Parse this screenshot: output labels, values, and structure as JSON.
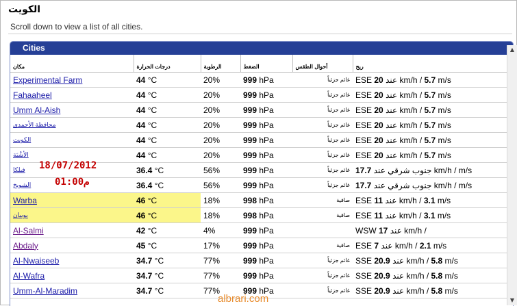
{
  "page": {
    "title": "الكويت",
    "subtitle": "Scroll down to view a list of all cities."
  },
  "panel": {
    "title": "Cities"
  },
  "columns": {
    "place": "مكان",
    "temperature": "درجات الحرارة",
    "humidity": "الرطوبة",
    "pressure": "الضغط",
    "weather": "أحوال الطقس",
    "wind": "ريح"
  },
  "rows": [
    {
      "city": "Experimental Farm",
      "temp": "44",
      "temp_unit": " °C",
      "humidity": "20%",
      "pressure": "999",
      "pressure_unit": " hPa",
      "weather": "غائم جزئياً",
      "wind_pre": "ESE ",
      "wind_kmh": "20",
      "wind_mid": " عند km/h / ",
      "wind_ms": "5.7",
      "wind_post": " m/s"
    },
    {
      "city": "Fahaaheel",
      "temp": "44",
      "temp_unit": " °C",
      "humidity": "20%",
      "pressure": "999",
      "pressure_unit": " hPa",
      "weather": "غائم جزئياً",
      "wind_pre": "ESE ",
      "wind_kmh": "20",
      "wind_mid": " عند km/h / ",
      "wind_ms": "5.7",
      "wind_post": " m/s"
    },
    {
      "city": "Umm Al-Aish",
      "temp": "44",
      "temp_unit": " °C",
      "humidity": "20%",
      "pressure": "999",
      "pressure_unit": " hPa",
      "weather": "غائم جزئياً",
      "wind_pre": "ESE ",
      "wind_kmh": "20",
      "wind_mid": " عند km/h / ",
      "wind_ms": "5.7",
      "wind_post": " m/s"
    },
    {
      "city": "محافظة الأحمدي",
      "temp": "44",
      "temp_unit": " °C",
      "humidity": "20%",
      "pressure": "999",
      "pressure_unit": " hPa",
      "weather": "غائم جزئياً",
      "wind_pre": "ESE ",
      "wind_kmh": "20",
      "wind_mid": " عند km/h / ",
      "wind_ms": "5.7",
      "wind_post": " m/s"
    },
    {
      "city": "الكويت",
      "temp": "44",
      "temp_unit": " °C",
      "humidity": "20%",
      "pressure": "999",
      "pressure_unit": " hPa",
      "weather": "غائم جزئياً",
      "wind_pre": "ESE ",
      "wind_kmh": "20",
      "wind_mid": " عند km/h / ",
      "wind_ms": "5.7",
      "wind_post": " m/s"
    },
    {
      "city": "الأشْبَة",
      "temp": "44",
      "temp_unit": " °C",
      "humidity": "20%",
      "pressure": "999",
      "pressure_unit": " hPa",
      "weather": "غائم جزئياً",
      "wind_pre": "ESE ",
      "wind_kmh": "20",
      "wind_mid": " عند km/h / ",
      "wind_ms": "5.7",
      "wind_post": " m/s"
    },
    {
      "city": "فيلكا",
      "temp": "36.4",
      "temp_unit": " °C",
      "humidity": "56%",
      "pressure": "999",
      "pressure_unit": " hPa",
      "weather": "غائم جزئياً",
      "wind_pre": "",
      "wind_kmh": "17.7",
      "wind_mid": " جنوب شرقي عند km/h /  m/s",
      "wind_ms": "",
      "wind_post": ""
    },
    {
      "city": "الشويخ",
      "temp": "36.4",
      "temp_unit": " °C",
      "humidity": "56%",
      "pressure": "999",
      "pressure_unit": " hPa",
      "weather": "غائم جزئياً",
      "wind_pre": "",
      "wind_kmh": "17.7",
      "wind_mid": " جنوب شرقي عند km/h /  m/s",
      "wind_ms": "",
      "wind_post": ""
    },
    {
      "city": "Warba",
      "temp": "46",
      "temp_unit": " °C",
      "humidity": "18%",
      "pressure": "998",
      "pressure_unit": " hPa",
      "weather": "صافية",
      "wind_pre": "ESE ",
      "wind_kmh": "11",
      "wind_mid": " عند km/h / ",
      "wind_ms": "3.1",
      "wind_post": " m/s",
      "highlight": true
    },
    {
      "city": "بوبيان",
      "temp": "46",
      "temp_unit": " °C",
      "humidity": "18%",
      "pressure": "998",
      "pressure_unit": " hPa",
      "weather": "صافية",
      "wind_pre": "ESE ",
      "wind_kmh": "11",
      "wind_mid": " عند km/h / ",
      "wind_ms": "3.1",
      "wind_post": " m/s",
      "highlight": true
    },
    {
      "city": "Al-Salmi",
      "temp": "42",
      "temp_unit": " °C",
      "humidity": "4%",
      "pressure": "999",
      "pressure_unit": " hPa",
      "weather": "",
      "wind_pre": "WSW ",
      "wind_kmh": "17",
      "wind_mid": " عند km/h /",
      "wind_ms": "",
      "wind_post": "",
      "visited": true
    },
    {
      "city": "Abdaly",
      "temp": "45",
      "temp_unit": " °C",
      "humidity": "17%",
      "pressure": "999",
      "pressure_unit": " hPa",
      "weather": "صافية",
      "wind_pre": "ESE ",
      "wind_kmh": "7",
      "wind_mid": " عند km/h / ",
      "wind_ms": "2.1",
      "wind_post": " m/s",
      "visited": true
    },
    {
      "city": "Al-Nwaiseeb",
      "temp": "34.7",
      "temp_unit": " °C",
      "humidity": "77%",
      "pressure": "999",
      "pressure_unit": " hPa",
      "weather": "غائم جزئياً",
      "wind_pre": "SSE ",
      "wind_kmh": "20.9",
      "wind_mid": " عند km/h / ",
      "wind_ms": "5.8",
      "wind_post": " m/s"
    },
    {
      "city": "Al-Wafra",
      "temp": "34.7",
      "temp_unit": " °C",
      "humidity": "77%",
      "pressure": "999",
      "pressure_unit": " hPa",
      "weather": "غائم جزئياً",
      "wind_pre": "SSE ",
      "wind_kmh": "20.9",
      "wind_mid": " عند km/h / ",
      "wind_ms": "5.8",
      "wind_post": " m/s"
    },
    {
      "city": "Umm-Al-Maradim",
      "temp": "34.7",
      "temp_unit": " °C",
      "humidity": "77%",
      "pressure": "999",
      "pressure_unit": " hPa",
      "weather": "غائم جزئياً",
      "wind_pre": "SSE ",
      "wind_kmh": "20.9",
      "wind_mid": " عند km/h / ",
      "wind_ms": "5.8",
      "wind_post": " m/s"
    }
  ],
  "overlay": {
    "date": "18/07/2012",
    "time": "01:00م"
  },
  "watermark": "albrari.com",
  "colors": {
    "panel_header": "#253f96",
    "link": "#1a1aa8",
    "visited_link": "#6a1a8a",
    "highlight": "#fbf68a",
    "overlay_text": "#c40000",
    "watermark": "#e88a2a"
  }
}
